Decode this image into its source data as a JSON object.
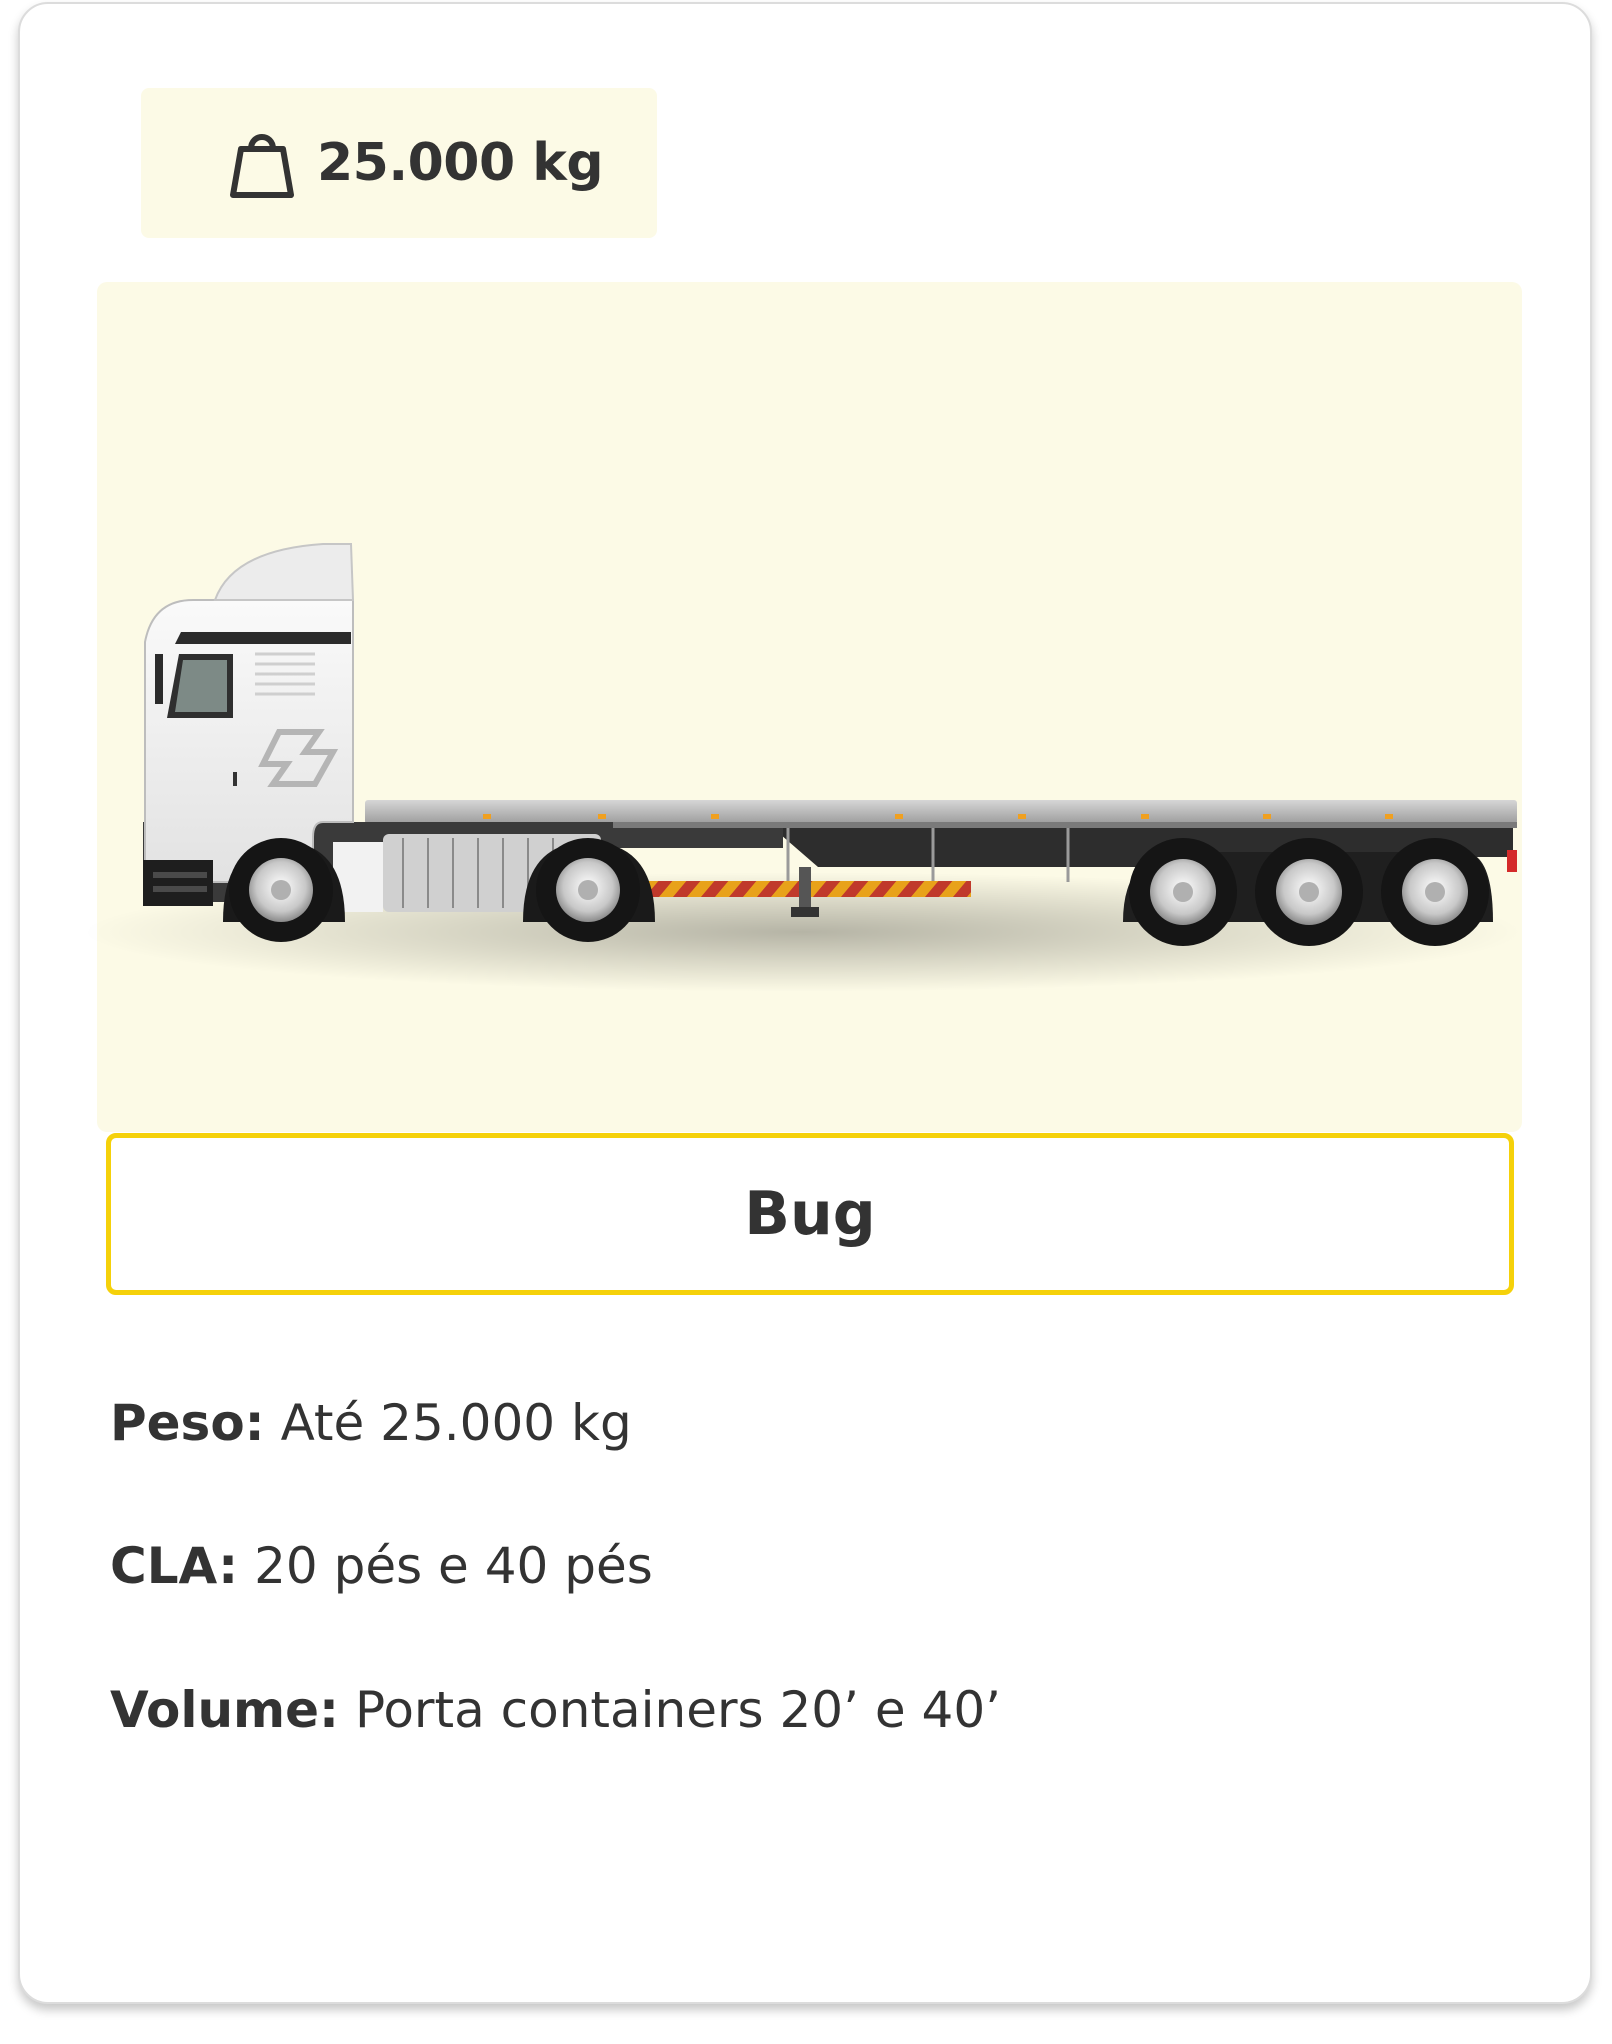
{
  "card": {
    "weight_badge": {
      "icon": "weight-bag-icon",
      "text": "25.000 kg"
    },
    "image": {
      "icon": "flatbed-truck-illustration"
    },
    "title": "Bug",
    "specs": [
      {
        "label": "Peso:",
        "value": "Até 25.000 kg"
      },
      {
        "label": "CLA:",
        "value": "20 pés e 40 pés"
      },
      {
        "label": "Volume:",
        "value": "Porta containers 20’ e 40’"
      }
    ]
  },
  "colors": {
    "accent": "#f5d10a",
    "badge_background": "#fcfae6",
    "text": "#333333"
  }
}
